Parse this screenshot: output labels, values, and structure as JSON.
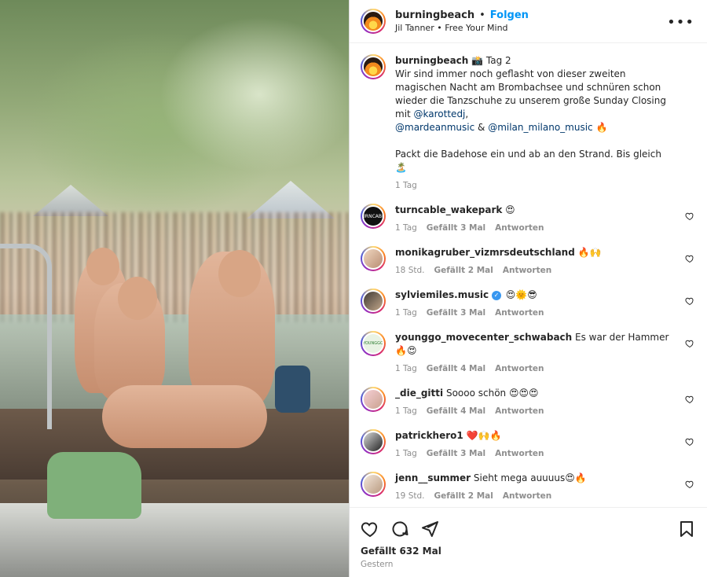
{
  "header": {
    "username": "burningbeach",
    "separator": "•",
    "follow_label": "Folgen",
    "subtitle": "Jil Tanner • Free Your Mind",
    "more_label": "•••"
  },
  "caption": {
    "username": "burningbeach",
    "line1": " 📸 Tag 2",
    "text_a": "Wir sind immer noch geflasht von dieser zweiten magischen Nacht am Brombachsee und schnüren schon wieder die Tanzschuhe zu unserem große Sunday Closing mit ",
    "mention1": "@karottedj",
    "text_b": ",",
    "mention2": "@mardeanmusic",
    "text_c": " & ",
    "mention3": "@milan_milano_music",
    "text_d": " 🔥",
    "line2": "Packt die Badehose ein und ab an den Strand. Bis gleich 🏝️",
    "time": "1 Tag"
  },
  "comments": [
    {
      "username": "turncable_wakepark",
      "verified": false,
      "text": " 😍",
      "time": "1 Tag",
      "likes": "Gefällt 3 Mal",
      "reply": "Antworten",
      "avatar_text": "TURNCABLE"
    },
    {
      "username": "monikagruber_vizmrsdeutschland",
      "verified": false,
      "text": " 🔥🙌",
      "time": "18 Std.",
      "likes": "Gefällt 2 Mal",
      "reply": "Antworten",
      "avatar_text": ""
    },
    {
      "username": "sylviemiles.music",
      "verified": true,
      "text": " 😍🌞😎",
      "time": "1 Tag",
      "likes": "Gefällt 3 Mal",
      "reply": "Antworten",
      "avatar_text": ""
    },
    {
      "username": "younggo_movecenter_schwabach",
      "verified": false,
      "text": " Es war der Hammer 🔥😍",
      "time": "1 Tag",
      "likes": "Gefällt 4 Mal",
      "reply": "Antworten",
      "avatar_text": "YOUNGGO"
    },
    {
      "username": "_die_gitti",
      "verified": false,
      "text": " Soooo schön 😍😍😍",
      "time": "1 Tag",
      "likes": "Gefällt 4 Mal",
      "reply": "Antworten",
      "avatar_text": ""
    },
    {
      "username": "patrickhero1",
      "verified": false,
      "text": " ❤️🙌🔥",
      "time": "1 Tag",
      "likes": "Gefällt 3 Mal",
      "reply": "Antworten",
      "avatar_text": ""
    },
    {
      "username": "jenn__summer",
      "verified": false,
      "text": " Sieht mega auuuus😍🔥",
      "time": "19 Std.",
      "likes": "Gefällt 2 Mal",
      "reply": "Antworten",
      "avatar_text": ""
    }
  ],
  "footer": {
    "likes": "Gefällt 632 Mal",
    "date": "Gestern"
  },
  "icons": {
    "like": "heart-icon",
    "comment": "comment-icon",
    "share": "send-icon",
    "save": "bookmark-icon",
    "more": "more-icon"
  },
  "colors": {
    "accent": "#0095f6",
    "mention": "#00376b",
    "muted": "#8e8e8e"
  }
}
